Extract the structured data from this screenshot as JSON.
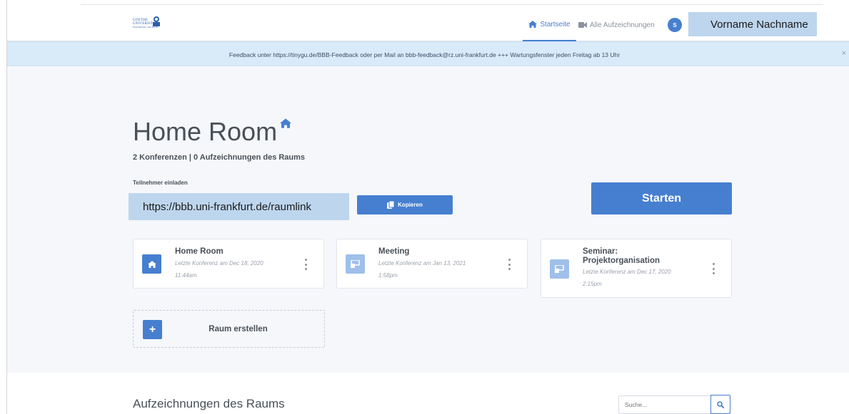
{
  "header": {
    "logo": {
      "line1": "GOETHE",
      "line2": "UNIVERSITÄT",
      "line3": "FRANKFURT AM MAIN",
      "icon": "university-logo-icon"
    },
    "nav": {
      "home_label": "Startseite",
      "home_icon": "home-icon",
      "recordings_label": "Alle Aufzeichnungen",
      "recordings_icon": "video-icon"
    },
    "avatar_initial": "S",
    "username": "Vorname Nachname"
  },
  "banner": {
    "text": "Feedback unter https://tinygu.de/BBB-Feedback oder per Mail an bbb-feedback@rz.uni-frankfurt.de +++ Wartungsfenster jeden Freitag ab 13 Uhr",
    "close": "×"
  },
  "room": {
    "title": "Home Room",
    "subtitle": "2 Konferenzen | 0 Aufzeichnungen des Raums",
    "invite_label": "Teilnehmer einladen",
    "invite_link": "https://bbb.uni-frankfurt.de/raumlink",
    "copy_label": "Kopieren",
    "start_label": "Starten"
  },
  "rooms": [
    {
      "name": "Home Room",
      "last": "Letzte Konferenz am Dec 18, 2020",
      "time": "11:44am",
      "icon": "home-icon"
    },
    {
      "name": "Meeting",
      "last": "Letzte Konferenz am Jan 13, 2021",
      "time": "1:58pm",
      "icon": "presentation-icon"
    },
    {
      "name_line1": "Seminar:",
      "name_line2": "Projektorganisation",
      "last": "Letzte Konferenz am Dec 17, 2020",
      "time": "2:15pm",
      "icon": "presentation-icon"
    }
  ],
  "create_room": {
    "label": "Raum erstellen",
    "icon": "plus-icon"
  },
  "recordings": {
    "title": "Aufzeichnungen des Raums",
    "search_placeholder": "Suche...",
    "search_icon": "search-icon"
  },
  "colors": {
    "primary": "#467fcf",
    "banner": "#d9eaf8",
    "highlight": "#bdd6ee",
    "background": "#f5f7fb"
  }
}
